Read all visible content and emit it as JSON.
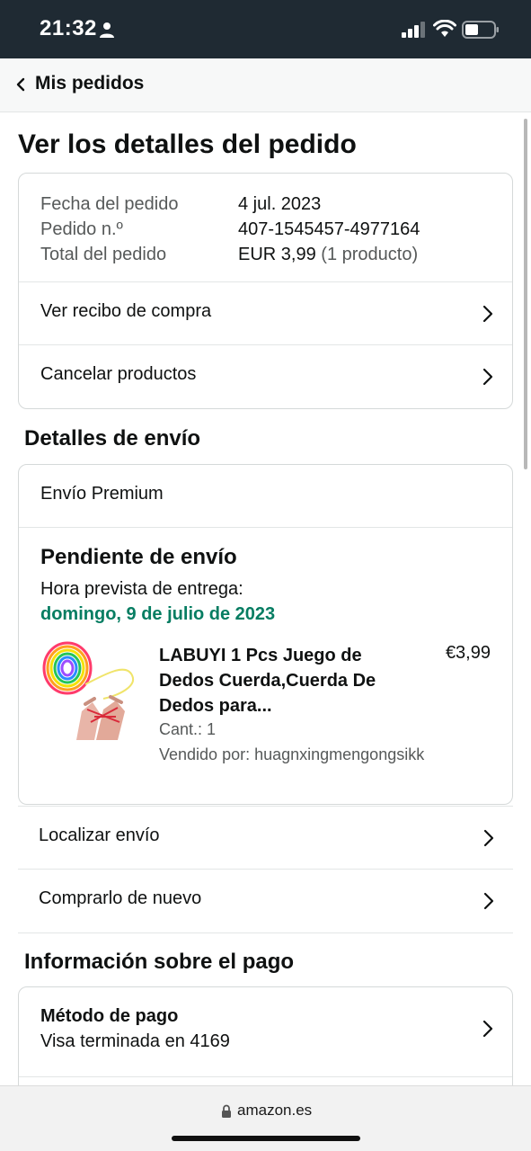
{
  "status_bar": {
    "time": "21:32"
  },
  "nav": {
    "back_label": "Mis pedidos"
  },
  "page": {
    "title": "Ver los detalles del pedido"
  },
  "order_summary": {
    "rows": [
      {
        "label": "Fecha del pedido",
        "value": "4 jul. 2023"
      },
      {
        "label": "Pedido n.º",
        "value": "407-1545457-4977164"
      },
      {
        "label": "Total del pedido",
        "value": "EUR 3,99",
        "extra": "(1 producto)"
      }
    ],
    "links": [
      "Ver recibo de compra",
      "Cancelar productos"
    ]
  },
  "shipping": {
    "section_title": "Detalles de envío",
    "method": "Envío Premium",
    "status": "Pendiente de envío",
    "delivery_label": "Hora prevista de entrega:",
    "delivery_date": "domingo, 9 de julio de 2023",
    "product": {
      "title": "LABUYI 1 Pcs Juego de Dedos Cuerda,Cuerda De Dedos para...",
      "price": "€3,99",
      "qty": "Cant.: 1",
      "seller": "Vendido por: huagnxingmengongsikk"
    },
    "links": [
      "Localizar envío",
      "Comprarlo de nuevo"
    ]
  },
  "payment": {
    "section_title": "Información sobre el pago",
    "method_title": "Método de pago",
    "method_value": "Visa terminada en 4169"
  },
  "browser": {
    "url": "amazon.es"
  },
  "colors": {
    "accent_green": "#067d62",
    "status_bar": "#1f2a33"
  }
}
